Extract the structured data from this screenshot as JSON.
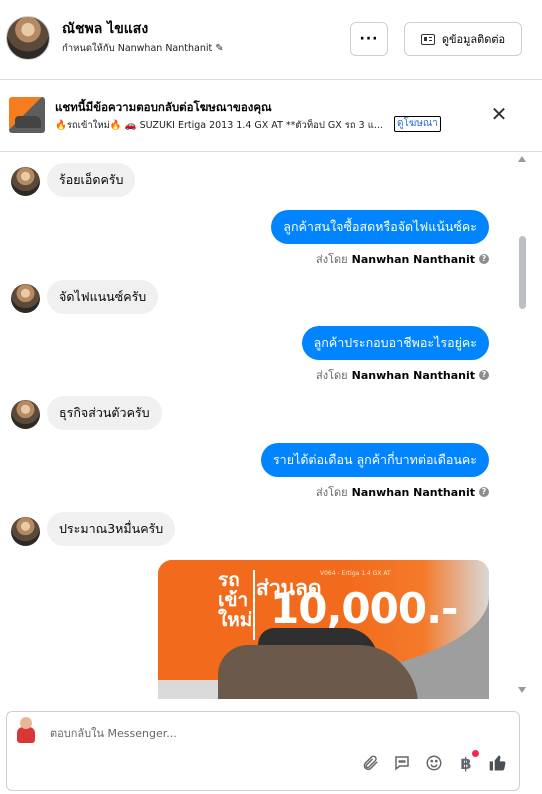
{
  "header": {
    "contact_name": "ณัชพล ไขแสง",
    "assigned_text": "กำหนดให้กับ Nanwhan Nanthanit",
    "more_label": "···",
    "contact_info_label": "ดูข้อมูลติดต่อ"
  },
  "ad_banner": {
    "title": "แชทนี้มีข้อความตอบกลับต่อโฆษณาของคุณ",
    "description": "🔥รถเข้าใหม่🔥 🚗 SUZUKI Ertiga 2013 1.4 GX AT **ตัวท็อป GX รถ 3 แ...",
    "link_label": "ดูโฆษณา",
    "close_label": "✕"
  },
  "messages": [
    {
      "direction": "in",
      "text": "ร้อยเอ็ดครับ"
    },
    {
      "direction": "out",
      "text": "ลูกค้าสนใจซื้อสดหรือจัดไฟแน้นซ์คะ",
      "sent_by_prefix": "ส่งโดย",
      "sent_by_name": "Nanwhan Nanthanit"
    },
    {
      "direction": "in",
      "text": "จัดไฟแนนซ์ครับ"
    },
    {
      "direction": "out",
      "text": "ลูกค้าประกอบอาชีพอะไรอยู่คะ",
      "sent_by_prefix": "ส่งโดย",
      "sent_by_name": "Nanwhan Nanthanit"
    },
    {
      "direction": "in",
      "text": "ธุรกิจส่วนตัวครับ"
    },
    {
      "direction": "out",
      "text": "รายได้ต่อเดือน ลูกค้ากี่บาทต่อเดือนคะ",
      "sent_by_prefix": "ส่งโดย",
      "sent_by_name": "Nanwhan Nanthanit"
    },
    {
      "direction": "in",
      "text": "ประมาณ3หมื่นครับ"
    }
  ],
  "ad_image": {
    "text_new_car": "รถ\nเข้า\nใหม่",
    "text_discount": "ส่วนลด",
    "text_amount": "10,000.-",
    "text_model": "V064 - Ertiga 1.4 GX AT"
  },
  "composer": {
    "placeholder": "ตอบกลับใน Messenger...",
    "icons": [
      "paperclip-icon",
      "saved-reply-icon",
      "emoji-icon",
      "baht-icon",
      "thumbs-up-icon"
    ],
    "baht_glyph": "฿"
  },
  "colors": {
    "outgoing_bubble": "#0084ff",
    "incoming_bubble": "#f0f0f0",
    "link": "#216fdb",
    "notification": "#f02849"
  }
}
